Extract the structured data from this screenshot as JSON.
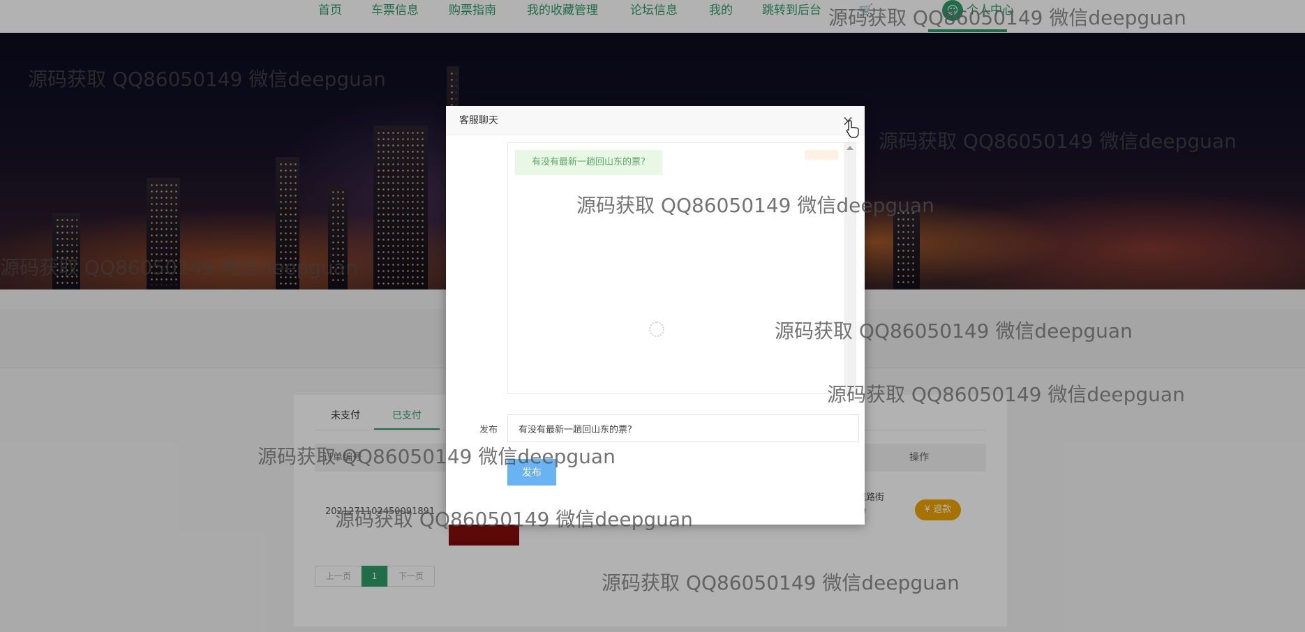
{
  "nav": {
    "items": [
      "首页",
      "车票信息",
      "购票指南",
      "我的收藏管理",
      "论坛信息",
      "我的",
      "跳转到后台"
    ],
    "trailing_label": "个人中心"
  },
  "orders": {
    "tabs": [
      "未支付",
      "已支付"
    ],
    "active_tab": "已支付",
    "columns": {
      "order_no": "订单编号",
      "actions": "操作"
    },
    "row": {
      "order_no": "2021271102450091891",
      "address": "上海市环城路街道幸福广场",
      "refund_label": "退款"
    },
    "pagination": {
      "prev": "上一页",
      "current": "1",
      "next": "下一页"
    }
  },
  "dialog": {
    "title": "客服聊天",
    "close_glyph": "×",
    "messages": [
      {
        "text": "有没有最新一趟回山东的票?"
      }
    ],
    "post_label": "发布",
    "input_value": "有没有最新一趟回山东的票?",
    "submit_label": "发布"
  },
  "watermark": "源码获取 QQ86050149 微信deepguan",
  "colors": {
    "accent": "#2e9c6b",
    "submit": "#69b3f2",
    "refund": "#f0a500",
    "bubble_bg": "#e9f8e4"
  }
}
